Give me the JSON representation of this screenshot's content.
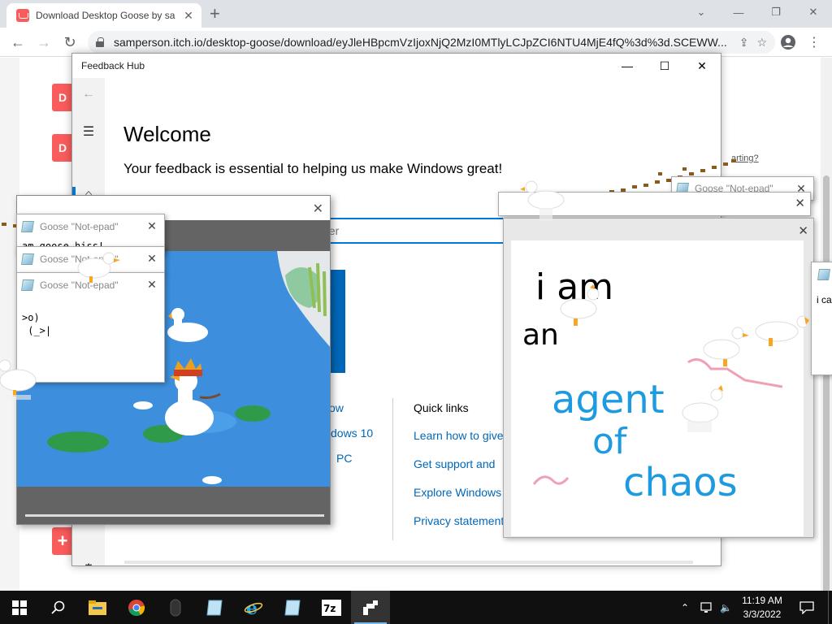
{
  "browser": {
    "tab_title": "Download Desktop Goose by sa",
    "url": "samperson.itch.io/desktop-goose/download/eyJleHBpcmVzIjoxNjQ2MzI0MTlyLCJpZCI6NTU4MjE4fQ%3d%3d.SCEWW..."
  },
  "itch": {
    "button_letter": "D",
    "add_button": "+",
    "starting_link": "arting?"
  },
  "feedback_hub": {
    "title": "Feedback Hub",
    "welcome": "Welcome",
    "subtitle": "Your feedback is essential to helping us make Windows great!",
    "search_placeholder": "ter",
    "left_links": [
      "ow",
      "dows 10",
      "PC"
    ],
    "quick_links_heading": "Quick links",
    "quick_links": [
      "Learn how to give",
      "Get support and",
      "Explore Windows",
      "Privacy statement"
    ]
  },
  "notepads": [
    {
      "title": "Goose \"Not-epad\"",
      "body": "am goose hiss!"
    },
    {
      "title": "Goose \"Not-epad\"",
      "body": ""
    },
    {
      "title": "Goose \"Not-epad\"",
      "body": ">o)\n (_>|"
    }
  ],
  "right_notepads": [
    {
      "title": "Goose \"Not-epad\""
    }
  ],
  "far_right_note": {
    "body": "i car"
  },
  "drawing": {
    "lines": [
      "i am",
      "an",
      "agent",
      "of",
      "chaos"
    ],
    "colors": {
      "ink": "#000000",
      "blue": "#1e9be0",
      "pink": "#f0a0b4"
    }
  },
  "taskbar": {
    "time": "11:19 AM",
    "date": "3/3/2022"
  }
}
